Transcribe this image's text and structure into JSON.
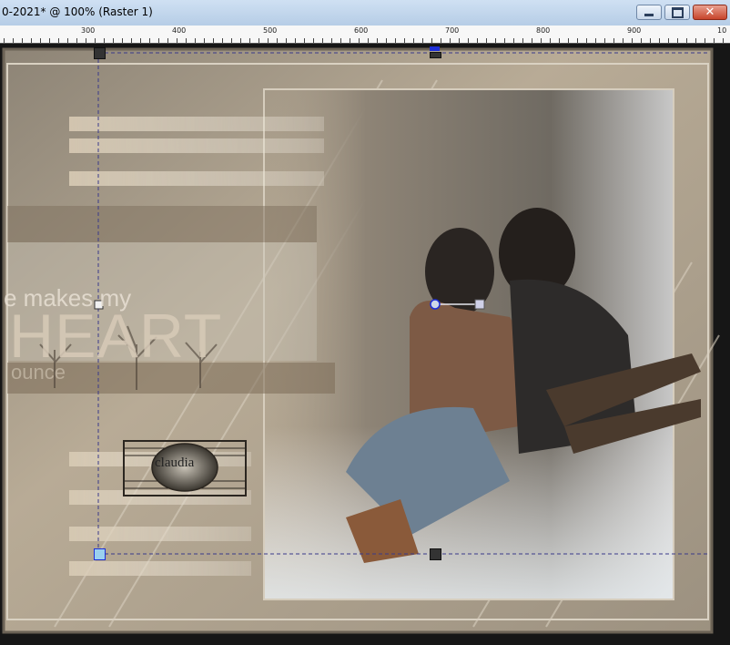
{
  "window": {
    "title": "0-2021* @ 100% (Raster 1)",
    "minimize_icon": "minimize-icon",
    "maximize_icon": "maximize-icon",
    "close_icon": "close-icon"
  },
  "ruler": {
    "labels": [
      "300",
      "400",
      "500",
      "600",
      "700",
      "800",
      "900",
      "10"
    ]
  },
  "artwork": {
    "line1": "e makes my",
    "line2": "HEART",
    "line3": "ounce",
    "signature": "claudia"
  },
  "colors": {
    "titlebar": "#cfe0f3",
    "close_button": "#c7442b",
    "selection_handle_active": "#1e2fd8",
    "canvas_tone": "#b8ab96"
  }
}
